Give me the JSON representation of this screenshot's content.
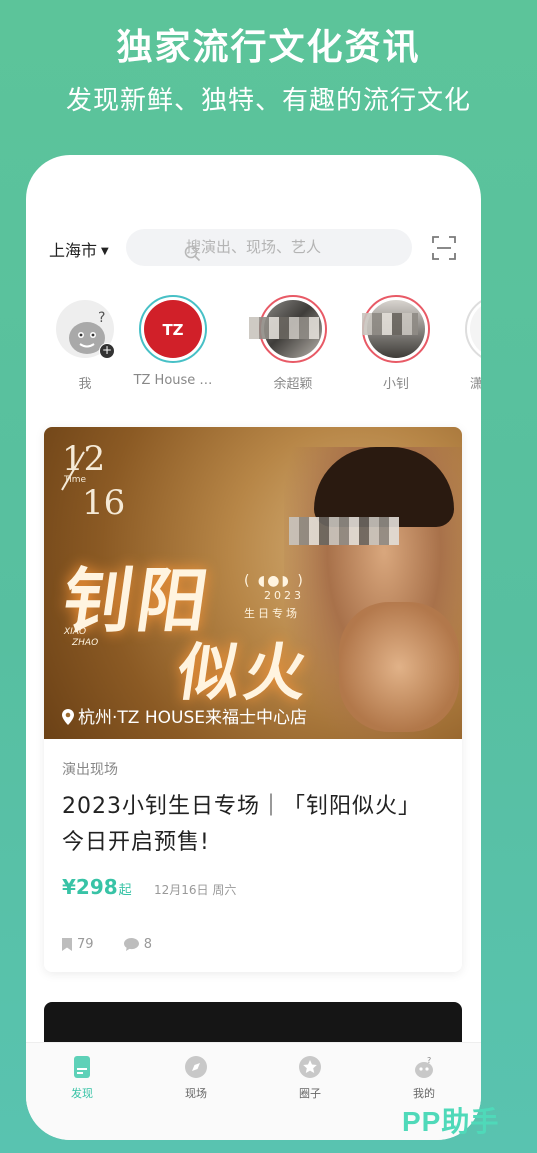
{
  "promo": {
    "title": "独家流行文化资讯",
    "subtitle": "发现新鲜、独特、有趣的流行文化"
  },
  "header": {
    "city": "上海市",
    "search_placeholder": "搜演出、现场、艺人"
  },
  "stories": [
    {
      "label": "我",
      "icon": "avatar-mascot"
    },
    {
      "label": "TZ House …",
      "logo_text": "TZ HOUSE"
    },
    {
      "label": "余超颖"
    },
    {
      "label": "小钊"
    },
    {
      "label": "潇"
    }
  ],
  "card": {
    "poster": {
      "date_top": "12",
      "time_label": "Time",
      "date_bottom": "16",
      "title_line1": "钊阳",
      "title_line2": "似火",
      "english_line1": "XIAO",
      "english_line2": "ZHAO",
      "year": "2023",
      "subtitle": "生日专场",
      "venue": "杭州·TZ HOUSE来福士中心店"
    },
    "category": "演出现场",
    "title": "2023小钊生日专场｜「钊阳似火」 今日开启预售!",
    "price": "¥298",
    "price_suffix": "起",
    "date": "12月16日 周六",
    "bookmarks": "79",
    "comments": "8"
  },
  "tabs": [
    {
      "label": "发现",
      "active": true,
      "icon": "discover-icon"
    },
    {
      "label": "现场",
      "active": false,
      "icon": "compass-icon"
    },
    {
      "label": "圈子",
      "active": false,
      "icon": "star-icon"
    },
    {
      "label": "我的",
      "active": false,
      "icon": "profile-icon"
    }
  ],
  "watermark": "PP助手",
  "colors": {
    "accent": "#38c3a6",
    "background": "#5cc49a",
    "story_ring": "#e85a66",
    "brand_red": "#d12029"
  }
}
